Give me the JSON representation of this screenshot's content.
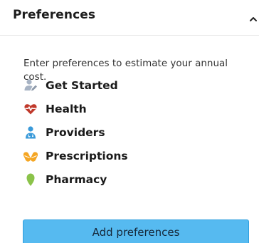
{
  "panel": {
    "title": "Preferences",
    "collapse_icon": "chevron-up-icon",
    "intro_text": "Enter preferences to estimate your annual cost.",
    "steps": [
      {
        "label": "Get Started",
        "icon": "user-edit-icon",
        "color": "#a7b3c4"
      },
      {
        "label": "Health",
        "icon": "heart-pulse-icon",
        "color": "#c0392b"
      },
      {
        "label": "Providers",
        "icon": "doctor-icon",
        "color": "#3a9ad9"
      },
      {
        "label": "Prescriptions",
        "icon": "pills-icon",
        "color": "#f5a623"
      },
      {
        "label": "Pharmacy",
        "icon": "location-pin-icon",
        "color": "#8bc34a"
      }
    ],
    "add_button_label": "Add preferences",
    "add_button_color": "#56baf0"
  }
}
